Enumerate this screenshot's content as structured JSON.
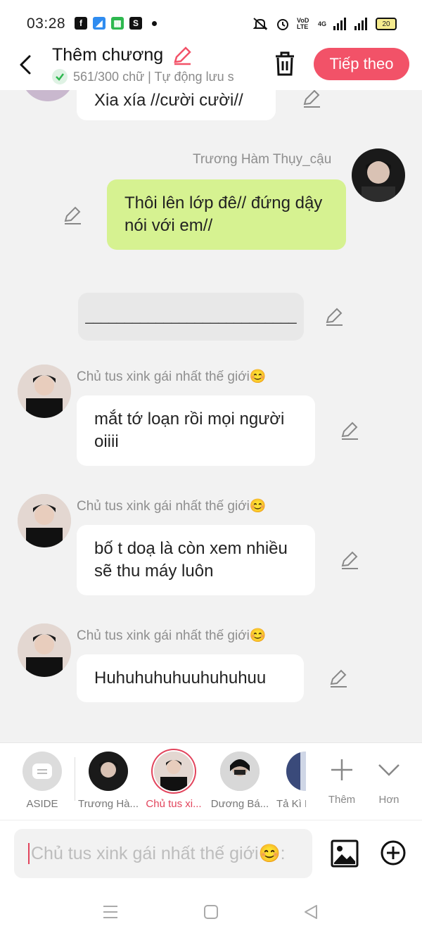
{
  "status_bar": {
    "time": "03:28",
    "apps": [
      "facebook-app-icon",
      "messenger-app-icon",
      "store-app-icon",
      "shopee-app-icon"
    ],
    "net_label": "VoD LTE",
    "net_type": "4G",
    "battery": "20"
  },
  "header": {
    "title": "Thêm chương",
    "word_count": "561/300 chữ | Tự động lưu s",
    "next_label": "Tiếp theo"
  },
  "messages": [
    {
      "type": "bubble",
      "text": "Xia xía //cười cười//"
    },
    {
      "type": "bubble",
      "sender": "Trương Hàm Thụy_cậu",
      "text": "Thôi lên lớp đê// đứng dậy nói với em//"
    },
    {
      "type": "aside",
      "text": "___________________________"
    },
    {
      "type": "bubble",
      "sender": "Chủ tus xink gái nhất thế giới😊",
      "text": "mắt tớ loạn rồi mọi người oiiii"
    },
    {
      "type": "bubble",
      "sender": "Chủ tus xink gái nhất thế giới😊",
      "text": "bố t doạ là còn xem nhiều sẽ thu máy luôn"
    },
    {
      "type": "bubble",
      "sender": "Chủ tus xink gái nhất thế giới😊",
      "text": "Huhuhuhuhuuhuhuhuu"
    }
  ],
  "characters": [
    {
      "label": "ASIDE"
    },
    {
      "label": "Trương Hà..."
    },
    {
      "label": "Chủ tus xi..."
    },
    {
      "label": "Dương Bá..."
    },
    {
      "label": "Tả Kì H"
    }
  ],
  "tools": {
    "add_label": "Thêm",
    "more_label": "Hơn"
  },
  "input": {
    "placeholder": "Chủ tus xink gái nhất thế giới😊:"
  },
  "colors": {
    "accent": "#f25268",
    "bubble_green": "#d6f291",
    "active_red": "#e2445c"
  }
}
